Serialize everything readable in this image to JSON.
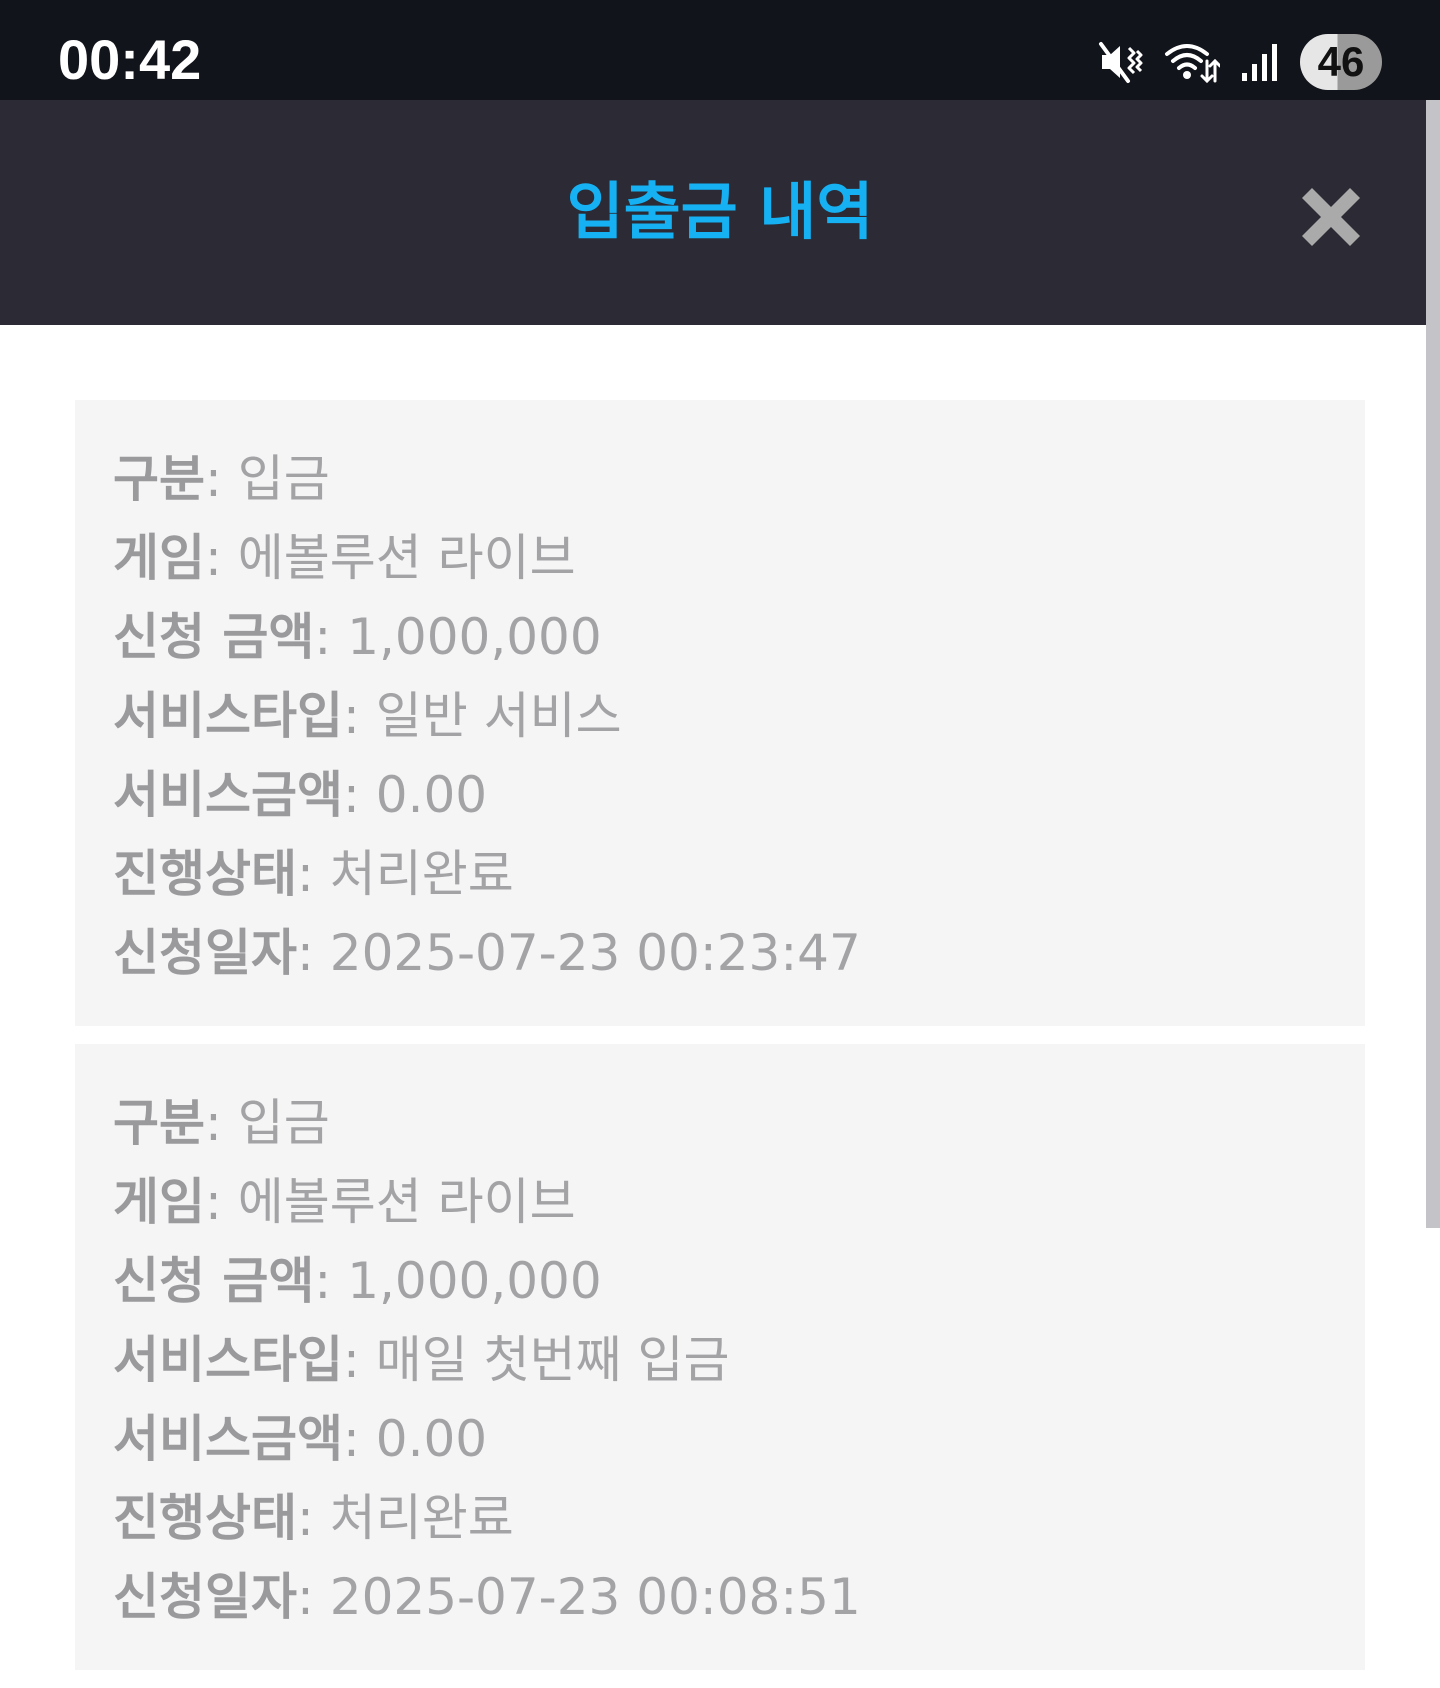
{
  "status_bar": {
    "time": "00:42",
    "battery": "46",
    "icons": [
      "mute-vibrate-icon",
      "wifi-icon",
      "signal-icon",
      "battery-icon"
    ]
  },
  "header": {
    "title": "입출금 내역",
    "close_icon": "close-icon"
  },
  "colors": {
    "status_bar_bg": "#12141b",
    "header_bg": "#2b2a35",
    "title_color": "#15b1f3",
    "card_bg": "#f5f5f6",
    "text_gray": "#a0a0a3"
  },
  "separator": ":",
  "transactions": [
    {
      "type_label": "구분",
      "type_value": "입금",
      "game_label": "게임",
      "game_value": "에볼루션 라이브",
      "amount_label": "신청 금액",
      "amount_value": "1,000,000",
      "service_type_label": "서비스타입",
      "service_type_value": "일반 서비스",
      "service_amount_label": "서비스금액",
      "service_amount_value": "0.00",
      "status_label": "진행상태",
      "status_value": "처리완료",
      "date_label": "신청일자",
      "date_value": "2025-07-23 00:23:47"
    },
    {
      "type_label": "구분",
      "type_value": "입금",
      "game_label": "게임",
      "game_value": "에볼루션 라이브",
      "amount_label": "신청 금액",
      "amount_value": "1,000,000",
      "service_type_label": "서비스타입",
      "service_type_value": "매일 첫번째 입금",
      "service_amount_label": "서비스금액",
      "service_amount_value": "0.00",
      "status_label": "진행상태",
      "status_value": "처리완료",
      "date_label": "신청일자",
      "date_value": "2025-07-23 00:08:51"
    }
  ]
}
